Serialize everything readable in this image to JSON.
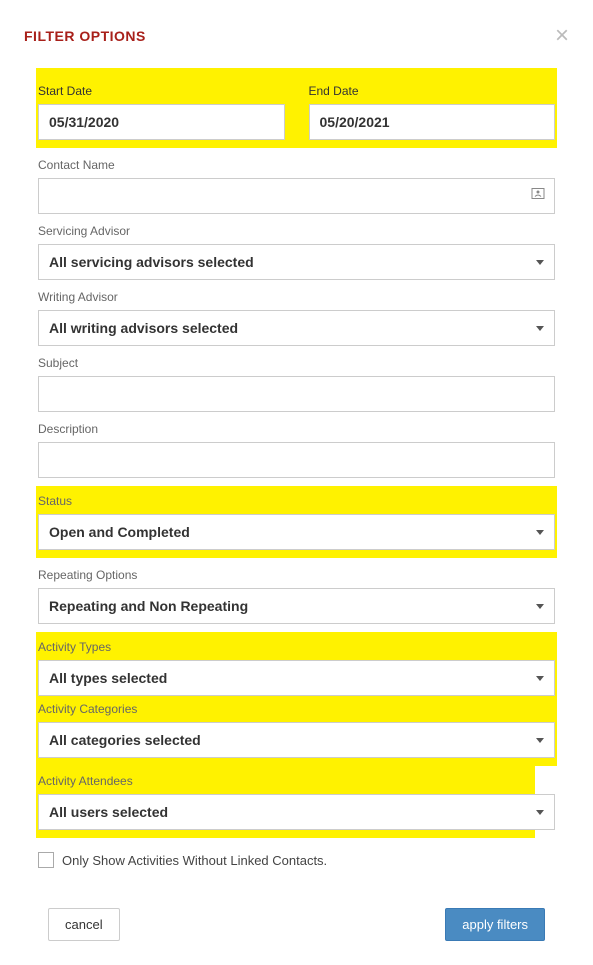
{
  "header": {
    "title": "FILTER OPTIONS"
  },
  "dates": {
    "start_label": "Start Date",
    "start_value": "05/31/2020",
    "end_label": "End Date",
    "end_value": "05/20/2021"
  },
  "contact": {
    "label": "Contact Name",
    "value": ""
  },
  "servicing_advisor": {
    "label": "Servicing Advisor",
    "value": "All servicing advisors selected"
  },
  "writing_advisor": {
    "label": "Writing Advisor",
    "value": "All writing advisors selected"
  },
  "subject": {
    "label": "Subject",
    "value": ""
  },
  "description": {
    "label": "Description",
    "value": ""
  },
  "status": {
    "label": "Status",
    "value": "Open and Completed"
  },
  "repeating": {
    "label": "Repeating Options",
    "value": "Repeating and Non Repeating"
  },
  "activity_types": {
    "label": "Activity Types",
    "value": "All types selected"
  },
  "activity_categories": {
    "label": "Activity Categories",
    "value": "All categories selected"
  },
  "activity_attendees": {
    "label": "Activity Attendees",
    "value": "All users selected"
  },
  "checkbox": {
    "label": "Only Show Activities Without Linked Contacts."
  },
  "footer": {
    "cancel": "cancel",
    "apply": "apply filters"
  }
}
